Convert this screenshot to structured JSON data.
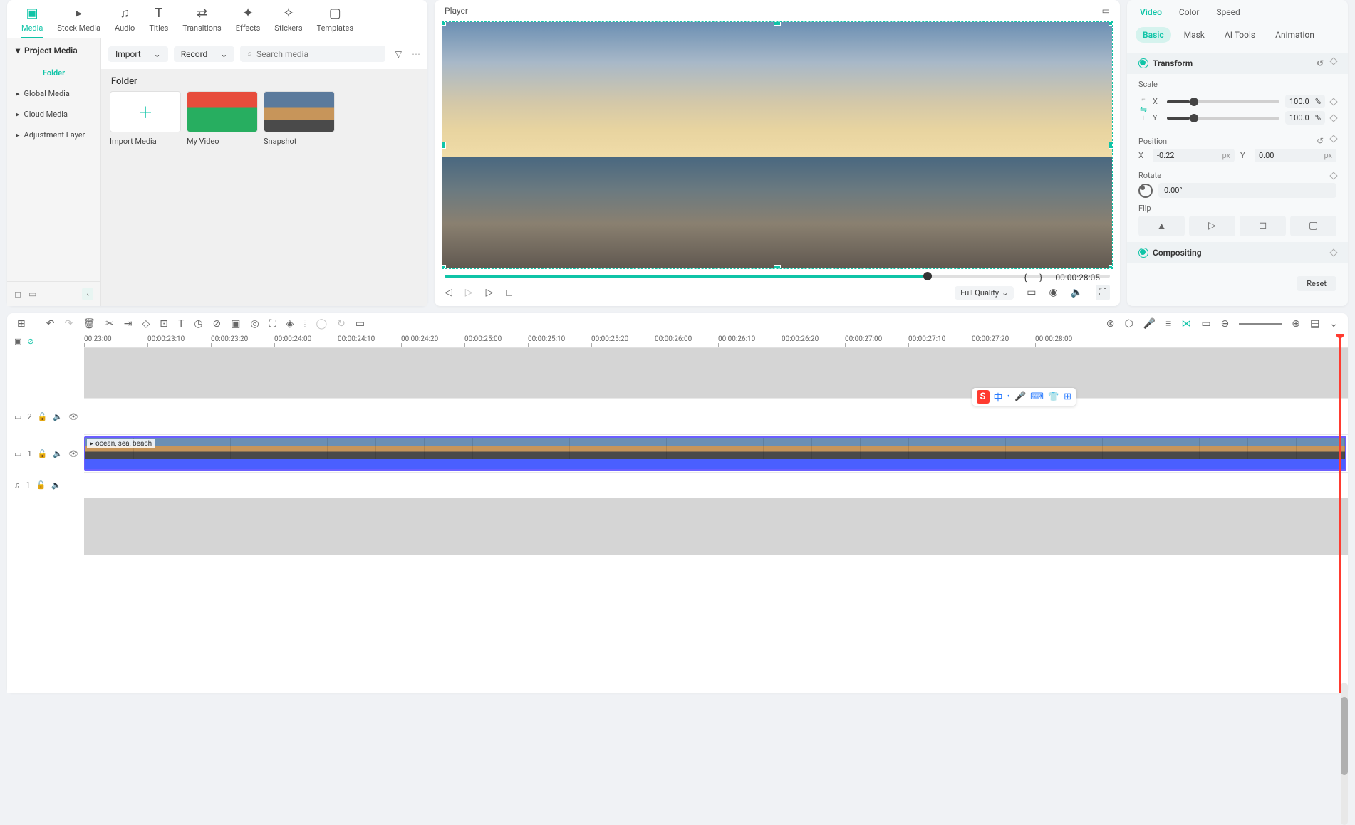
{
  "top_tabs": [
    {
      "label": "Media",
      "icon": "▣"
    },
    {
      "label": "Stock Media",
      "icon": "▸"
    },
    {
      "label": "Audio",
      "icon": "♫"
    },
    {
      "label": "Titles",
      "icon": "T"
    },
    {
      "label": "Transitions",
      "icon": "⇄"
    },
    {
      "label": "Effects",
      "icon": "✦"
    },
    {
      "label": "Stickers",
      "icon": "✧"
    },
    {
      "label": "Templates",
      "icon": "▢"
    }
  ],
  "sidebar": {
    "header": "Project Media",
    "items": [
      {
        "label": "Folder",
        "active": true
      },
      {
        "label": "Global Media"
      },
      {
        "label": "Cloud Media"
      },
      {
        "label": "Adjustment Layer"
      }
    ]
  },
  "media_toolbar": {
    "import": "Import",
    "record": "Record",
    "search_placeholder": "Search media"
  },
  "media_section_title": "Folder",
  "media_cards": [
    {
      "label": "Import Media",
      "type": "add"
    },
    {
      "label": "My Video",
      "type": "video1"
    },
    {
      "label": "Snapshot",
      "type": "video2"
    }
  ],
  "player": {
    "title": "Player",
    "timecode": "00:00:28:05",
    "quality": "Full Quality",
    "brace_open": "{",
    "brace_close": "}"
  },
  "props": {
    "tabs": [
      "Video",
      "Color",
      "Speed"
    ],
    "subtabs": [
      "Basic",
      "Mask",
      "AI Tools",
      "Animation"
    ],
    "transform_title": "Transform",
    "scale_label": "Scale",
    "scale_x": "100.0",
    "scale_y": "100.0",
    "pct": "%",
    "x_axis": "X",
    "y_axis": "Y",
    "position_label": "Position",
    "pos_x": "-0.22",
    "pos_y": "0.00",
    "px": "px",
    "rotate_label": "Rotate",
    "rotate_val": "0.00°",
    "flip_label": "Flip",
    "compositing_title": "Compositing",
    "reset": "Reset"
  },
  "timeline": {
    "ruler": [
      "00:23:00",
      "00:00:23:10",
      "00:00:23:20",
      "00:00:24:00",
      "00:00:24:10",
      "00:00:24:20",
      "00:00:25:00",
      "00:00:25:10",
      "00:00:25:20",
      "00:00:26:00",
      "00:00:26:10",
      "00:00:26:20",
      "00:00:27:00",
      "00:00:27:10",
      "00:00:27:20",
      "00:00:28:00"
    ],
    "clip_label": "ocean, sea, beach",
    "track2_num": "2",
    "track1_num": "1",
    "audio_num": "1"
  },
  "floater_text": "中"
}
